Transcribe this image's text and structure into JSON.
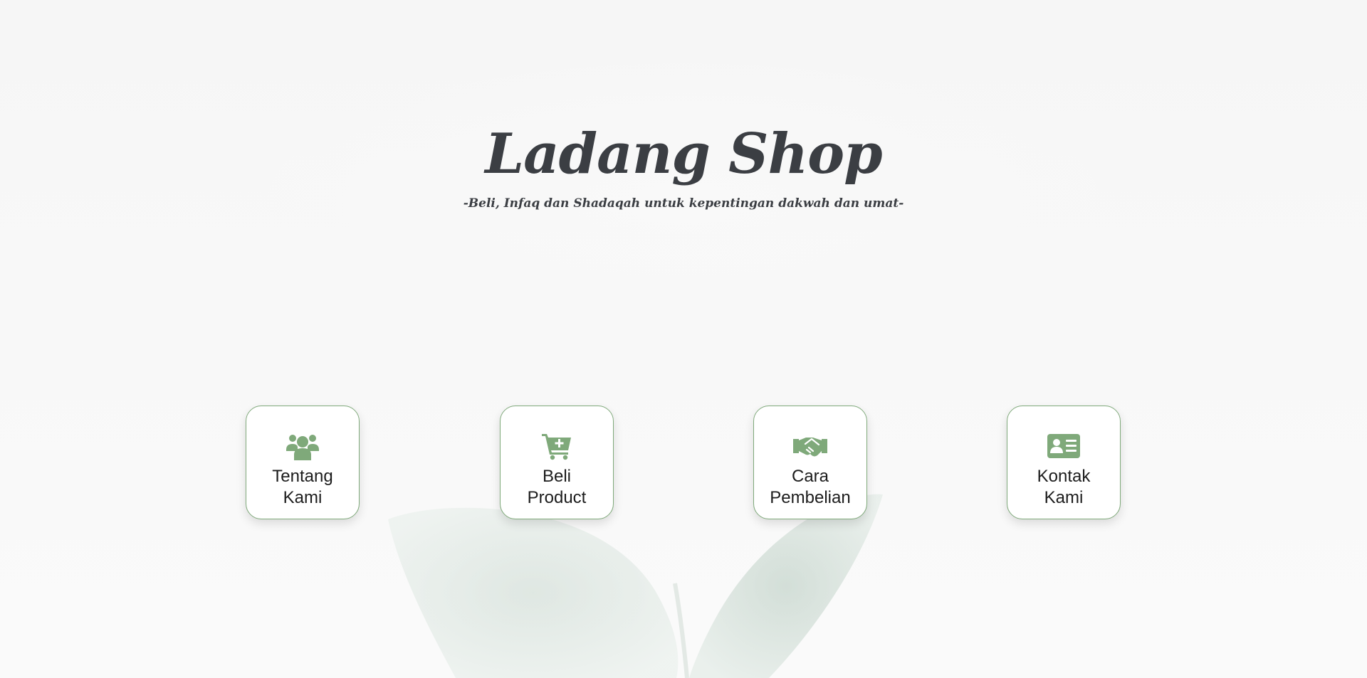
{
  "hero": {
    "title": "Ladang Shop",
    "tagline": "-Beli, Infaq dan Shadaqah untuk kepentingan dakwah dan umat-"
  },
  "theme": {
    "accent": "#7fa97a",
    "text": "#3b3e43"
  },
  "menu": [
    {
      "icon": "users-icon",
      "line1": "Tentang",
      "line2": "Kami"
    },
    {
      "icon": "cart-plus-icon",
      "line1": "Beli",
      "line2": "Product"
    },
    {
      "icon": "handshake-icon",
      "line1": "Cara",
      "line2": "Pembelian"
    },
    {
      "icon": "contact-card-icon",
      "line1": "Kontak",
      "line2": "Kami"
    }
  ]
}
